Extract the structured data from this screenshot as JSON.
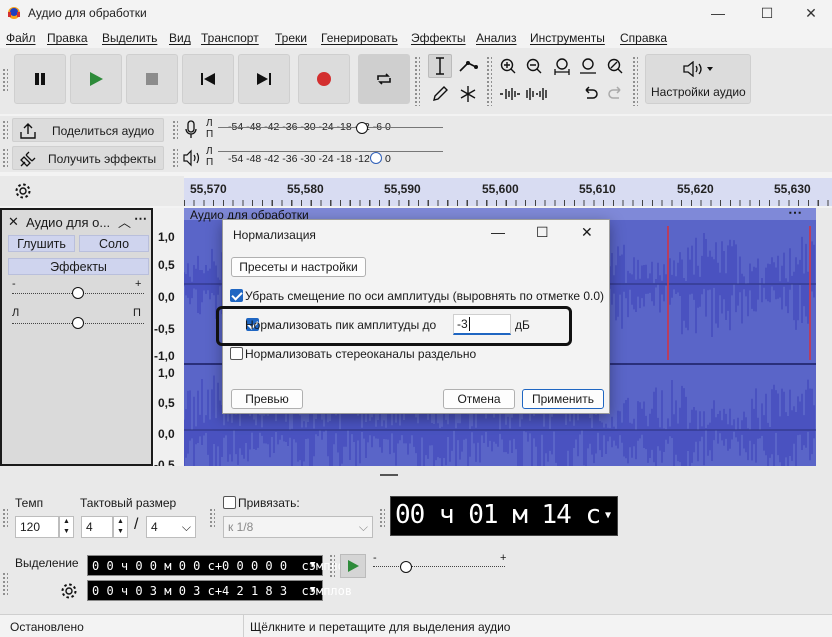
{
  "window": {
    "title": "Аудио для обработки",
    "minimize": "—",
    "maximize": "☐",
    "close": "✕"
  },
  "menu": [
    "Файл",
    "Правка",
    "Выделить",
    "Вид",
    "Транспорт",
    "Треки",
    "Генерировать",
    "Эффекты",
    "Анализ",
    "Инструменты",
    "Справка"
  ],
  "toolbar": {
    "audio_settings": "Настройки аудио",
    "share_audio": "Поделиться аудио",
    "get_effects": "Получить эффекты"
  },
  "meters": {
    "rec_channels": "Л\nП",
    "scale_rec": "-54  -48  -42  -36  -30  -24  -18  -12   -6    0",
    "scale_play": "-54  -48  -42  -36  -30  -24  -18  -12   -6    0",
    "rec_level": 0.64,
    "play_level": 0.7
  },
  "ruler": [
    "55,570",
    "55,580",
    "55,590",
    "55,600",
    "55,610",
    "55,620",
    "55,630"
  ],
  "track": {
    "name": "Аудио для о...",
    "mute": "Глушить",
    "solo": "Соло",
    "effects": "Эффекты",
    "gain_minus": "-",
    "gain_plus": "+",
    "pan_left": "Л",
    "pan_right": "П",
    "clip_title": "Аудио для обработки"
  },
  "scale_labels": [
    "1,0",
    "0,5",
    "0,0",
    "-0,5",
    "-1,0",
    "1,0",
    "0,5",
    "0,0",
    "-0,5"
  ],
  "dialog": {
    "title": "Нормализация",
    "presets": "Пресеты и настройки",
    "remove_dc": "Убрать смещение по оси амплитуды (выровнять по отметке 0.0)",
    "normalize_peak": "Нормализовать пик амплитуды до",
    "peak_value": "-3",
    "unit": "дБ",
    "stereo": "Нормализовать стереоканалы раздельно",
    "preview": "Превью",
    "cancel": "Отмена",
    "apply": "Применить"
  },
  "bottom": {
    "tempo_label": "Темп",
    "tempo": "120",
    "time_sig_label": "Тактовый размер",
    "ts_num": "4",
    "ts_sep": "/",
    "ts_den": "4",
    "snap_label": "Привязать:",
    "snap_value": "к 1/8",
    "big_time": "00 ч 01 м 14 с",
    "selection_label": "Выделение",
    "sel_start": "0 0 ч 0 0 м 0 0 с+0 0 0 0 0  сэмплов",
    "sel_end": "0 0 ч 0 3 м 0 3 с+4 2 1 8 3  сэмплов",
    "play_minus": "-",
    "play_plus": "+",
    "play_level": 0.25
  },
  "status": {
    "left": "Остановлено",
    "right": "Щёлкните и перетащите для выделения аудио"
  },
  "colors": {
    "accent": "#1f66c2",
    "wave_bg": "#5a65c8",
    "wave": "#3940b8",
    "ruler": "#d8dcf2",
    "record": "#d32f2f",
    "play": "#2e8b3a"
  }
}
